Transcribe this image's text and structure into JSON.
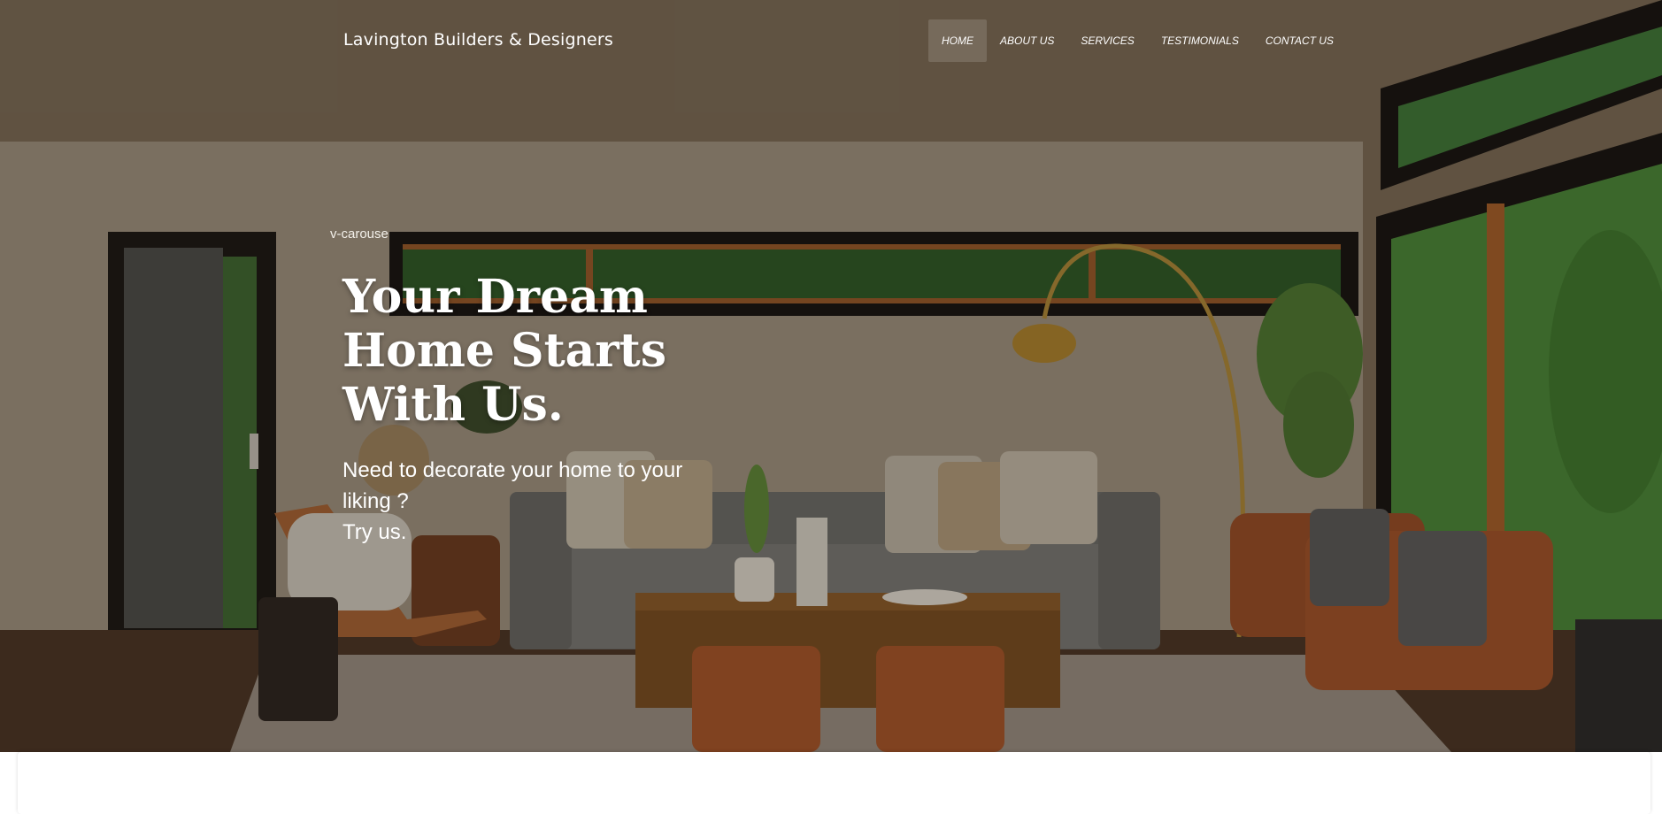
{
  "header": {
    "brand": "Lavington Builders & Designers",
    "nav": [
      {
        "label": "HOME",
        "active": true
      },
      {
        "label": "ABOUT US",
        "active": false
      },
      {
        "label": "SERVICES",
        "active": false
      },
      {
        "label": "TESTIMONIALS",
        "active": false
      },
      {
        "label": "CONTACT US",
        "active": false
      }
    ]
  },
  "hero": {
    "carousel_label": "v-carouse",
    "headline": "Your Dream Home Starts With Us.",
    "subtext_line1": "Need to decorate your home to your liking ?",
    "subtext_line2": "Try us."
  },
  "colors": {
    "nav_active_bg": "#ffffff24",
    "text": "#ffffff",
    "panel": "#ffffff"
  }
}
